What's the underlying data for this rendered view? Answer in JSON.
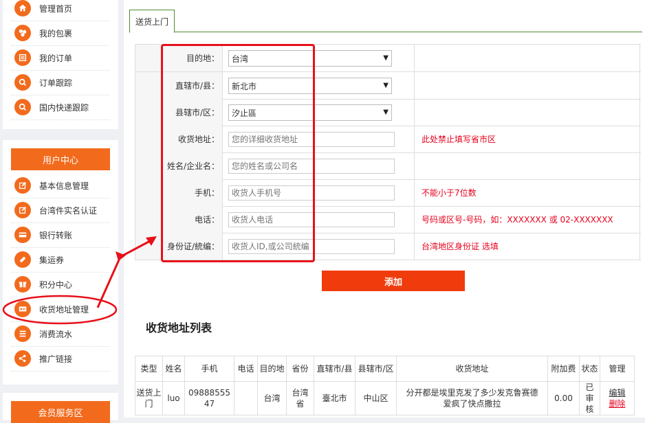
{
  "sidebar": {
    "top_items": [
      {
        "label": "管理首页",
        "icon": "home-icon"
      },
      {
        "label": "我的包裹",
        "icon": "packages-icon"
      },
      {
        "label": "我的订单",
        "icon": "orders-icon"
      },
      {
        "label": "订单跟踪",
        "icon": "search-icon"
      },
      {
        "label": "国内快递跟踪",
        "icon": "search-icon"
      }
    ],
    "user_center": {
      "title": "用户中心",
      "items": [
        {
          "label": "基本信息管理",
          "icon": "edit-icon"
        },
        {
          "label": "台湾件实名认证",
          "icon": "edit-icon"
        },
        {
          "label": "银行转账",
          "icon": "card-icon"
        },
        {
          "label": "集运券",
          "icon": "ticket-icon"
        },
        {
          "label": "积分中心",
          "icon": "gift-icon"
        },
        {
          "label": "收货地址管理",
          "icon": "id-card-icon"
        },
        {
          "label": "消费流水",
          "icon": "list-icon"
        },
        {
          "label": "推广链接",
          "icon": "share-icon"
        }
      ]
    },
    "member_area": {
      "title": "会员服务区"
    }
  },
  "tab": {
    "label": "送货上门"
  },
  "form": {
    "destination": {
      "label": "目的地：",
      "value": "台湾"
    },
    "city": {
      "label": "直辖市/县：",
      "value": "新北市"
    },
    "district": {
      "label": "县辖市/区：",
      "value": "汐止區"
    },
    "address": {
      "label": "收货地址：",
      "placeholder": "您的详细收货地址",
      "hint": "此处禁止填写省市区"
    },
    "name": {
      "label": "姓名/企业名：",
      "placeholder": "您的姓名或公司名"
    },
    "mobile": {
      "label": "手机：",
      "placeholder": "收货人手机号",
      "hint": "不能小于7位数"
    },
    "phone": {
      "label": "电话：",
      "placeholder": "收货人电话",
      "hint": "号码或区号-号码，如：XXXXXXX 或 02-XXXXXXX"
    },
    "idcard": {
      "label": "身份证/統编：",
      "placeholder": "收货人ID,或公司統编",
      "hint": "台湾地区身份证 选填"
    },
    "submit_label": "添加"
  },
  "address_list": {
    "title": "收货地址列表",
    "columns": [
      "类型",
      "姓名",
      "手机",
      "电话",
      "目的地",
      "省份",
      "直辖市/县",
      "县辖市/区",
      "收货地址",
      "附加费",
      "状态",
      "管理"
    ],
    "rows": [
      {
        "type": "送货上门",
        "name": "luo",
        "mobile": "0988855547",
        "phone": "",
        "destination": "台湾",
        "province": "台湾省",
        "city": "臺北市",
        "district": "中山区",
        "address": "分开都是埃里克发了多少发克鲁赛德爱疯了快点撒拉",
        "surcharge": "0.00",
        "status": "已审核",
        "edit_label": "编辑",
        "delete_label": "删除"
      }
    ]
  },
  "colors": {
    "accent": "#f26b1d",
    "danger": "#e6001c",
    "button": "#f03c0c",
    "tab_border": "#4e8a2f"
  }
}
